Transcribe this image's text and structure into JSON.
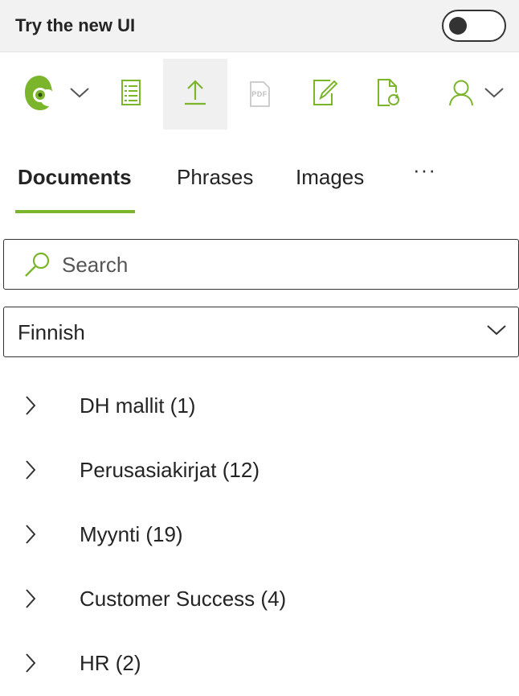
{
  "banner": {
    "label": "Try the new UI",
    "toggle_on": false
  },
  "toolbar": {
    "items": [
      {
        "name": "logo",
        "icon": "chameleon-logo-icon"
      },
      {
        "name": "document-list",
        "icon": "document-list-icon"
      },
      {
        "name": "upload",
        "icon": "upload-icon",
        "active": true
      },
      {
        "name": "pdf",
        "icon": "pdf-icon",
        "label": "PDF",
        "disabled": true
      },
      {
        "name": "edit",
        "icon": "edit-document-icon"
      },
      {
        "name": "refresh",
        "icon": "refresh-document-icon"
      },
      {
        "name": "user",
        "icon": "user-icon"
      }
    ]
  },
  "tabs": [
    {
      "label": "Documents",
      "selected": true
    },
    {
      "label": "Phrases",
      "selected": false
    },
    {
      "label": "Images",
      "selected": false
    }
  ],
  "more_label": "···",
  "search": {
    "placeholder": "Search",
    "value": ""
  },
  "language_select": {
    "value": "Finnish"
  },
  "tree": {
    "items": [
      {
        "label": "DH mallit (1)"
      },
      {
        "label": "Perusasiakirjat (12)"
      },
      {
        "label": "Myynti (19)"
      },
      {
        "label": "Customer Success (4)"
      },
      {
        "label": "HR (2)"
      }
    ]
  },
  "colors": {
    "accent": "#7ab52b",
    "text": "#242424",
    "banner_bg": "#f2f2f2",
    "border": "#333333",
    "disabled": "#bdbdbd"
  }
}
